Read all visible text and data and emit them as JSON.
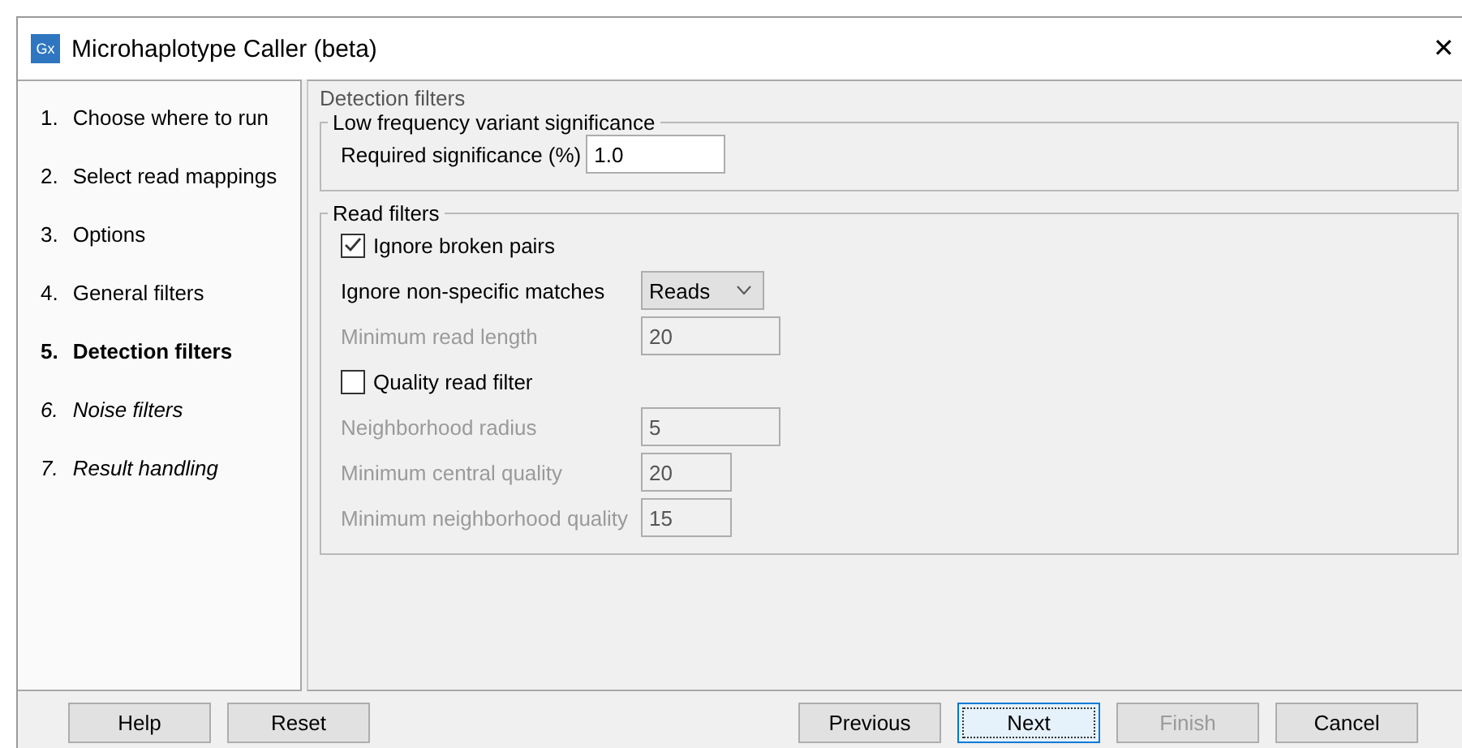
{
  "window": {
    "title": "Microhaplotype Caller (beta)",
    "icon": "Gx",
    "close": "✕"
  },
  "steps": [
    {
      "number": "1.",
      "label": "Choose where to run",
      "current": false,
      "pending": false
    },
    {
      "number": "2.",
      "label": "Select read mappings",
      "current": false,
      "pending": false
    },
    {
      "number": "3.",
      "label": "Options",
      "current": false,
      "pending": false
    },
    {
      "number": "4.",
      "label": "General filters",
      "current": false,
      "pending": false
    },
    {
      "number": "5.",
      "label": "Detection filters",
      "current": true,
      "pending": false
    },
    {
      "number": "6.",
      "label": "Noise filters",
      "current": false,
      "pending": true
    },
    {
      "number": "7.",
      "label": "Result handling",
      "current": false,
      "pending": true
    }
  ],
  "page_title": "Detection filters",
  "groups": [
    {
      "title": "Low frequency variant significance",
      "rows": [
        {
          "kind": "field",
          "label": "Required significance (%)",
          "value": "1.0",
          "disabled": false,
          "compact": false
        }
      ]
    },
    {
      "title": "Read filters",
      "rows": [
        {
          "kind": "checkbox",
          "label": "Ignore broken pairs",
          "checked": true
        },
        {
          "kind": "select",
          "label": "Ignore non-specific matches",
          "value": "Reads"
        },
        {
          "kind": "field",
          "label": "Minimum read length",
          "value": "20",
          "disabled": true,
          "compact": false
        },
        {
          "kind": "checkbox",
          "label": "Quality read filter",
          "checked": false
        },
        {
          "kind": "field",
          "label": "Neighborhood radius",
          "value": "5",
          "disabled": true,
          "compact": false
        },
        {
          "kind": "field",
          "label": "Minimum central quality",
          "value": "20",
          "disabled": true,
          "compact": true
        },
        {
          "kind": "field",
          "label": "Minimum neighborhood quality",
          "value": "15",
          "disabled": true,
          "compact": true
        }
      ]
    }
  ],
  "buttons_left": [
    {
      "label": "Help",
      "disabled": false,
      "focused": false
    },
    {
      "label": "Reset",
      "disabled": false,
      "focused": false
    }
  ],
  "buttons_right": [
    {
      "label": "Previous",
      "disabled": false,
      "focused": false
    },
    {
      "label": "Next",
      "disabled": false,
      "focused": true
    },
    {
      "label": "Finish",
      "disabled": true,
      "focused": false
    },
    {
      "label": "Cancel",
      "disabled": false,
      "focused": false
    }
  ]
}
